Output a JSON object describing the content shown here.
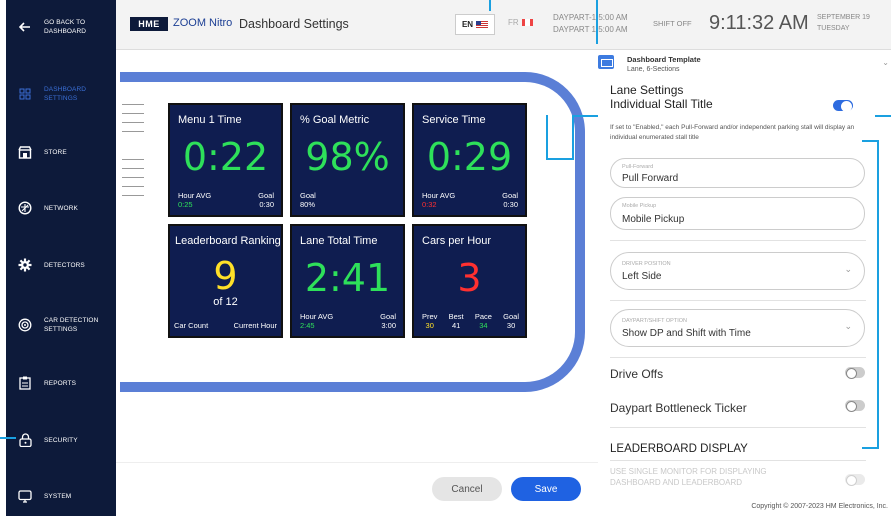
{
  "sidebar": {
    "items": [
      {
        "label": "GO BACK TO DASHBOARD",
        "icon": "arrow-left-icon"
      },
      {
        "label": "DASHBOARD SETTINGS",
        "icon": "grid-icon"
      },
      {
        "label": "STORE",
        "icon": "store-icon"
      },
      {
        "label": "NETWORK",
        "icon": "network-icon"
      },
      {
        "label": "DETECTORS",
        "icon": "gear-icon"
      },
      {
        "label": "CAR DETECTION SETTINGS",
        "icon": "target-icon"
      },
      {
        "label": "REPORTS",
        "icon": "clipboard-icon"
      },
      {
        "label": "SECURITY",
        "icon": "lock-icon"
      },
      {
        "label": "SYSTEM",
        "icon": "monitor-icon"
      }
    ]
  },
  "header": {
    "logo": "HME",
    "brand": "ZOOM Nitro",
    "title": "Dashboard Settings",
    "lang_en": "EN",
    "lang_fr": "FR",
    "daypart_1": "DAYPART-1  5:00 AM",
    "daypart_2": "DAYPART 1  5:00 AM",
    "shift": "SHIFT OFF",
    "clock": "9:11:32 AM",
    "date_1": "SEPTEMBER 19",
    "date_2": "TUESDAY"
  },
  "tiles": {
    "menu": {
      "title": "Menu 1 Time",
      "value": "0:22",
      "left_label": "Hour AVG",
      "left_value": "0:25",
      "right_label": "Goal",
      "right_value": "0:30"
    },
    "goal": {
      "title": "% Goal Metric",
      "value": "98%",
      "left_label": "Goal",
      "left_value": "80%"
    },
    "service": {
      "title": "Service Time",
      "value": "0:29",
      "left_label": "Hour AVG",
      "left_value": "0:32",
      "right_label": "Goal",
      "right_value": "0:30"
    },
    "leader": {
      "title": "Leaderboard Ranking",
      "value": "9",
      "of": "of 12",
      "left_label": "Car Count",
      "right_label": "Current Hour"
    },
    "lane": {
      "title": "Lane Total Time",
      "value": "2:41",
      "left_label": "Hour AVG",
      "left_value": "2:45",
      "right_label": "Goal",
      "right_value": "3:00"
    },
    "cars": {
      "title": "Cars per Hour",
      "value": "3",
      "stats": [
        {
          "label": "Prev",
          "value": "30"
        },
        {
          "label": "Best",
          "value": "41"
        },
        {
          "label": "Pace",
          "value": "34"
        },
        {
          "label": "Goal",
          "value": "30"
        }
      ]
    }
  },
  "panel": {
    "template_name": "Dashboard Template",
    "template_sub": "Lane, 6-Sections",
    "section_title": "Lane Settings",
    "stall_title": "Individual Stall Title",
    "help": "If set to \"Enabled,\" each Pull-Forward and/or independent parking stall will display an individual enumerated stall title",
    "pull_forward_label": "Pull-Forward",
    "pull_forward_value": "Pull Forward",
    "mobile_label": "Mobile Pickup",
    "mobile_value": "Mobile Pickup",
    "driver_label": "DRIVER POSITION",
    "driver_value": "Left Side",
    "daypart_label": "DAYPART/SHIFT OPTION",
    "daypart_value": "Show DP and Shift with Time",
    "drive_offs": "Drive Offs",
    "bottleneck": "Daypart Bottleneck Ticker",
    "leaderboard_title": "LEADERBOARD DISPLAY",
    "leaderboard_option": "USE SINGLE MONITOR FOR DISPLAYING DASHBOARD AND LEADERBOARD",
    "copyright": "Copyright © 2007-2023 HM Electronics, Inc."
  },
  "footer": {
    "cancel": "Cancel",
    "save": "Save"
  },
  "colors": {
    "sidebar": "#0d1a3a",
    "accent": "#1f62e2",
    "tile": "#0f1d50",
    "green": "#2ee05a",
    "red": "#ff3030",
    "yellow": "#ffe028"
  }
}
